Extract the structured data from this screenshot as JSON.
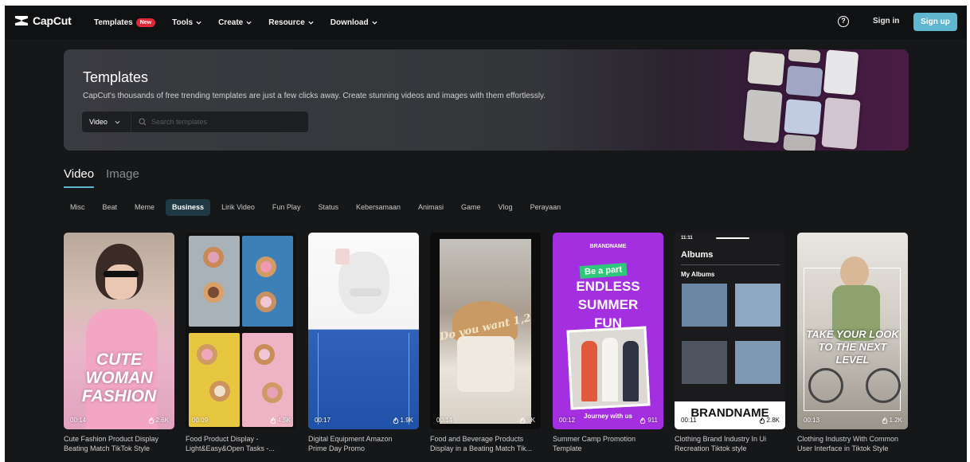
{
  "header": {
    "brand": "CapCut",
    "nav": [
      {
        "label": "Templates",
        "badge": "New",
        "chevron": false
      },
      {
        "label": "Tools",
        "chevron": true
      },
      {
        "label": "Create",
        "chevron": true
      },
      {
        "label": "Resource",
        "chevron": true
      },
      {
        "label": "Download",
        "chevron": true
      }
    ],
    "help_icon": "question-circle-icon",
    "signin_label": "Sign in",
    "signup_label": "Sign up",
    "accent": "#5fb6cf"
  },
  "hero": {
    "title": "Templates",
    "subtitle": "CapCut's thousands of free trending templates are just a few clicks away. Create stunning videos and images with them effortlessly.",
    "type_value": "Video",
    "search_placeholder": "Search templates"
  },
  "tabs": [
    {
      "label": "Video",
      "active": true
    },
    {
      "label": "Image",
      "active": false
    }
  ],
  "categories": [
    {
      "label": "Misc",
      "active": false
    },
    {
      "label": "Beat",
      "active": false
    },
    {
      "label": "Meme",
      "active": false
    },
    {
      "label": "Business",
      "active": true
    },
    {
      "label": "Lirik Video",
      "active": false
    },
    {
      "label": "Fun Play",
      "active": false
    },
    {
      "label": "Status",
      "active": false
    },
    {
      "label": "Kebersamaan",
      "active": false
    },
    {
      "label": "Animasi",
      "active": false
    },
    {
      "label": "Game",
      "active": false
    },
    {
      "label": "Vlog",
      "active": false
    },
    {
      "label": "Perayaan",
      "active": false
    }
  ],
  "templates": [
    {
      "duration": "00:14",
      "likes": "2.6K",
      "title_line1": "Cute Fashion Product Display",
      "title_line2": "Beating Match TikTok Style",
      "overlay": [
        "CUTE",
        "WOMAN",
        "FASHION"
      ]
    },
    {
      "duration": "00:09",
      "likes": "4.5K",
      "title_line1": "Food Product Display -",
      "title_line2": "Light&Easy&Open Tasks -..."
    },
    {
      "duration": "00:17",
      "likes": "1.9K",
      "title_line1": "Digital Equipment Amazon",
      "title_line2": "Prime Day Promo"
    },
    {
      "duration": "00:14",
      "likes": "9K",
      "title_line1": "Food and Beverage Products",
      "title_line2": "Display in a Beating Match Tik...",
      "overlay": [
        "Do you want 1,2"
      ]
    },
    {
      "duration": "00:12",
      "likes": "911",
      "title_line1": "Summer Camp Promotion",
      "title_line2": "Template",
      "overlay": [
        "BRANDNAME",
        "Be a part",
        "ENDLESS",
        "SUMMER",
        "FUN",
        "Journey with us"
      ]
    },
    {
      "duration": "00:11",
      "likes": "2.8K",
      "title_line1": "Clothing Brand Industry In Ui",
      "title_line2": "Recreation Tiktok style",
      "overlay": [
        "11:11",
        "Albums",
        "My Albums",
        "BRANDNAME"
      ]
    },
    {
      "duration": "00:13",
      "likes": "1.2K",
      "title_line1": "Clothing Industry With Common",
      "title_line2": "User Interface in Tiktok Style",
      "overlay": [
        "TAKE YOUR LOOK",
        "TO THE NEXT",
        "LEVEL"
      ]
    }
  ]
}
